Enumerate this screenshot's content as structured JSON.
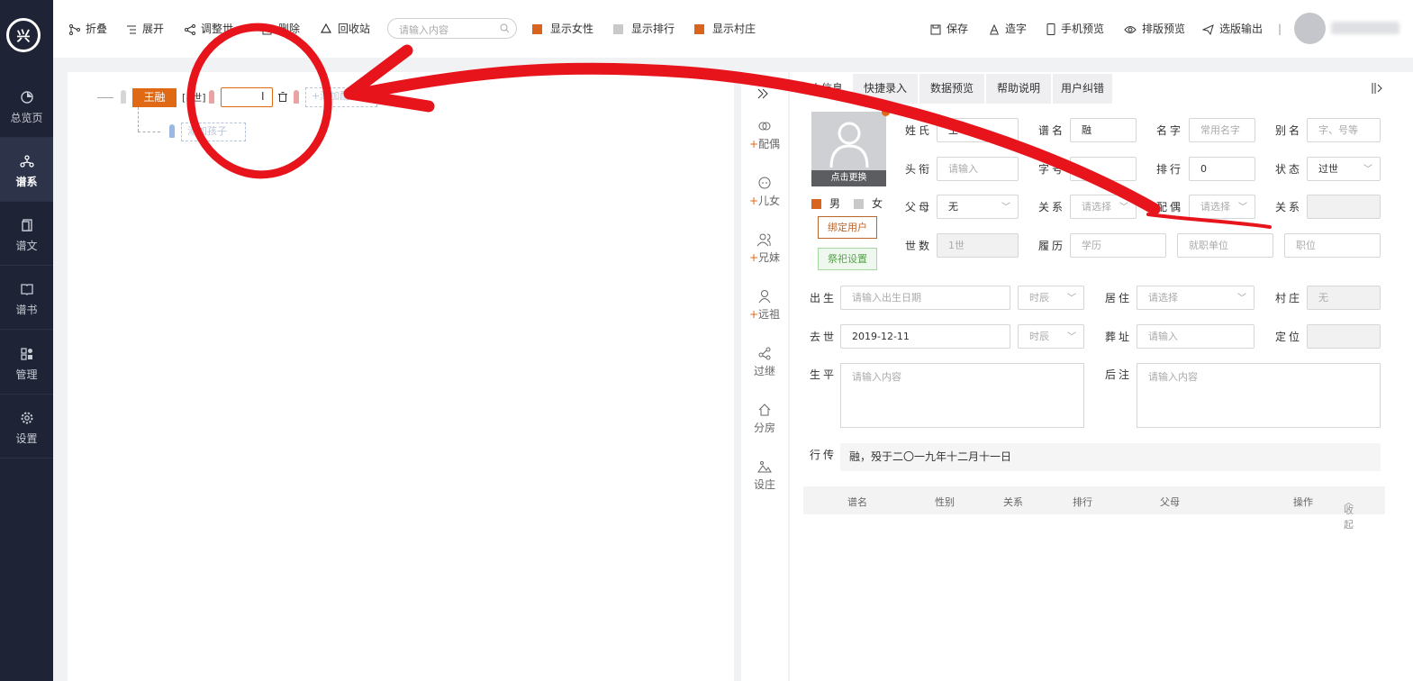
{
  "app": {
    "logo_text": "兴"
  },
  "sidebar": {
    "items": [
      {
        "label": "总览页",
        "icon": "pie-chart-icon"
      },
      {
        "label": "谱系",
        "icon": "tree-icon"
      },
      {
        "label": "谱文",
        "icon": "document-icon"
      },
      {
        "label": "谱书",
        "icon": "book-icon"
      },
      {
        "label": "管理",
        "icon": "grid-icon"
      },
      {
        "label": "设置",
        "icon": "gear-icon"
      }
    ]
  },
  "toolbar": {
    "collapse": "折叠",
    "expand": "展开",
    "adjust": "调整世",
    "delete": "删除",
    "recycle": "回收站",
    "search_placeholder": "请输入内容",
    "show_female": "显示女性",
    "show_rank": "显示排行",
    "show_village": "显示村庄",
    "save": "保存",
    "make_char": "造字",
    "mobile_preview": "手机预览",
    "layout_preview": "排版预览",
    "export": "选版输出",
    "divider": "|"
  },
  "tree": {
    "node_name": "王融",
    "generation": "[1世]",
    "add_spouse": "+添加配偶",
    "add_child": "添加孩子"
  },
  "sidecol": [
    {
      "plus": "+",
      "label": "配偶",
      "icon": "spouse-icon"
    },
    {
      "plus": "+",
      "label": "儿女",
      "icon": "child-icon"
    },
    {
      "plus": "+",
      "label": "兄妹",
      "icon": "siblings-icon"
    },
    {
      "plus": "+",
      "label": "远祖",
      "icon": "ancestor-icon"
    },
    {
      "plus": "",
      "label": "过继",
      "icon": "share-icon"
    },
    {
      "plus": "",
      "label": "分房",
      "icon": "home-icon"
    },
    {
      "plus": "",
      "label": "设庄",
      "icon": "landscape-icon"
    }
  ],
  "tabs": [
    "个人信息",
    "快捷录入",
    "数据预览",
    "帮助说明",
    "用户纠错"
  ],
  "form": {
    "photo_caption": "点击更换",
    "male": "男",
    "female": "女",
    "bind_user": "绑定用户",
    "sacrifice": "祭祀设置",
    "surname_label": "姓氏",
    "surname_value": "王",
    "pu_name_label": "谱名",
    "pu_name_value": "融",
    "given_name_label": "名字",
    "given_name_ph": "常用名字",
    "alias_label": "别名",
    "alias_ph": "字、号等",
    "title_label": "头衔",
    "title_ph": "请输入",
    "zi_label": "字号",
    "zi_value": "",
    "rank_label": "排行",
    "rank_value": "0",
    "status_label": "状态",
    "status_value": "过世",
    "parents_label": "父母",
    "parents_value": "无",
    "relation_label": "关系",
    "relation_ph": "请选择",
    "spouse_label": "配偶",
    "spouse_ph": "请选择",
    "relation2_label": "关系",
    "relation2_value": "",
    "gen_label": "世数",
    "gen_value": "1世",
    "resume_label": "履历",
    "edu_ph": "学历",
    "work_ph": "就职单位",
    "post_ph": "职位",
    "birth_label": "出生",
    "birth_ph": "请输入出生日期",
    "time_ph": "时辰",
    "live_label": "居住",
    "live_ph": "请选择",
    "village_label": "村庄",
    "village_value": "无",
    "death_label": "去世",
    "death_value": "2019-12-11",
    "burial_label": "葬址",
    "burial_ph": "请输入",
    "locate_label": "定位",
    "locate_value": "",
    "life_label": "生平",
    "life_ph": "请输入内容",
    "note_label": "后注",
    "note_ph": "请输入内容",
    "bio_label": "行传",
    "bio_value": "融，殁于二〇一九年十二月十一日"
  },
  "table": {
    "columns": [
      "谱名",
      "性别",
      "关系",
      "排行",
      "父母",
      "操作"
    ],
    "collapse": "收起"
  },
  "colors": {
    "accent": "#e06916",
    "sidebar": "#1e2335",
    "annotation": "#e8141c"
  }
}
